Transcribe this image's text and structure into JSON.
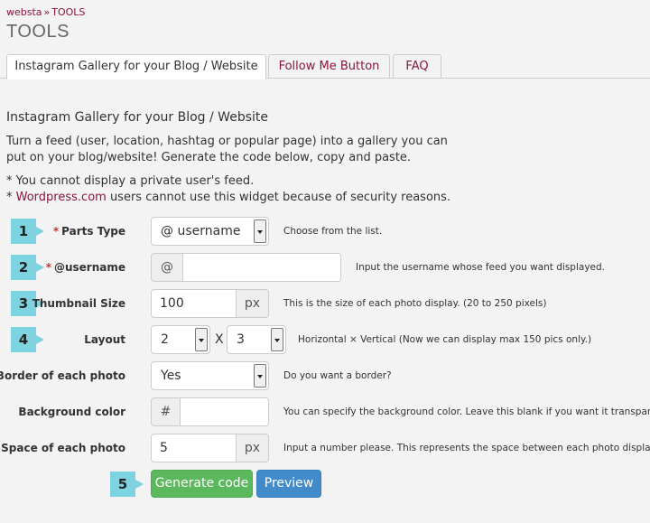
{
  "breadcrumb": {
    "home": "websta",
    "separator": "»",
    "current": "TOOLS"
  },
  "page_title": "TOOLS",
  "tabs": [
    {
      "label": "Instagram Gallery for your Blog / Website",
      "active": true
    },
    {
      "label": "Follow Me Button",
      "active": false
    },
    {
      "label": "FAQ",
      "active": false
    }
  ],
  "section": {
    "title": "Instagram Gallery for your Blog / Website",
    "intro_line1": "Turn a feed (user, location, hashtag or popular page) into a gallery you can",
    "intro_line2": "put on your blog/website! Generate the code below, copy and paste.",
    "note1": "* You cannot display a private user's feed.",
    "note2_prefix": "* ",
    "note2_link": "Wordpress.com",
    "note2_suffix": " users cannot use this widget because of security reasons."
  },
  "form": {
    "required_mark": "*",
    "parts_type": {
      "step": "1",
      "label": "Parts Type",
      "value": "@ username",
      "help": "Choose from the list."
    },
    "username": {
      "step": "2",
      "label": "@username",
      "prefix": "@",
      "value": "",
      "help": "Input the username whose feed you want displayed."
    },
    "thumbnail": {
      "step": "3",
      "label": "Thumbnail Size",
      "value": "100",
      "unit": "px",
      "help": "This is the size of each photo display. (20 to 250 pixels)"
    },
    "layout": {
      "step": "4",
      "label": "Layout",
      "horizontal": "2",
      "times": "X",
      "vertical": "3",
      "help": "Horizontal × Vertical  (Now we can display max 150 pics only.)"
    },
    "border": {
      "label": "Border of each photo",
      "value": "Yes",
      "help": "Do you want a border?"
    },
    "background": {
      "label": "Background color",
      "prefix": "#",
      "value": "",
      "help": "You can specify the background color. Leave this blank if you want it transparent."
    },
    "spacing": {
      "label": "Space of each photo",
      "value": "5",
      "unit": "px",
      "help": "Input a number please. This represents the space between each photo display."
    }
  },
  "actions": {
    "step": "5",
    "generate_label": "Generate code",
    "preview_label": "Preview"
  },
  "colors": {
    "link": "#8a1538",
    "step_badge": "#7ed3e0",
    "generate": "#5cb85c",
    "preview": "#428bca"
  }
}
